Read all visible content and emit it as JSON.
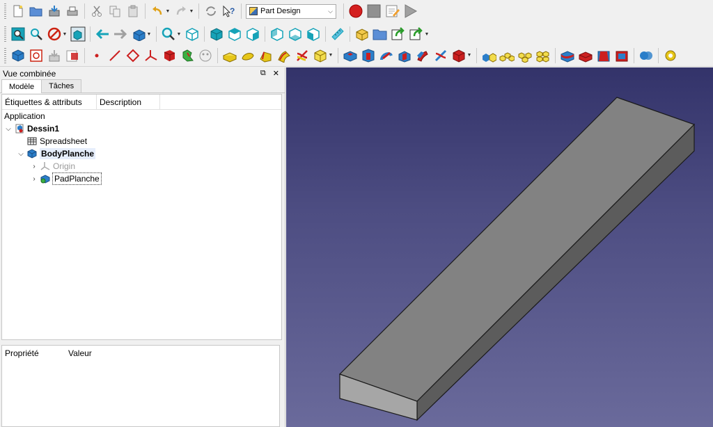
{
  "toolbar": {
    "workbench": "Part Design",
    "colors": {
      "record": "#d42020",
      "stop": "#909090",
      "play": "#a0a0a0",
      "nav_arrow": "#16a3b8",
      "cube_blue": "#2b7ec9",
      "pd_red": "#cc2020",
      "pd_yellow": "#e6c619"
    }
  },
  "combo": {
    "title": "Vue combinée",
    "tabs": [
      "Modèle",
      "Tâches"
    ],
    "columns": [
      "Étiquettes & attributs",
      "Description"
    ],
    "section": "Application",
    "tree": [
      {
        "label": "Dessin1",
        "level": 0,
        "bold": true,
        "expanded": true,
        "icon": "document-icon"
      },
      {
        "label": "Spreadsheet",
        "level": 1,
        "bold": false,
        "icon": "spreadsheet-icon"
      },
      {
        "label": "BodyPlanche",
        "level": 1,
        "bold": true,
        "expanded": true,
        "icon": "body-icon"
      },
      {
        "label": "Origin",
        "level": 2,
        "bold": false,
        "grey": true,
        "collapsed": true,
        "icon": "origin-icon"
      },
      {
        "label": "PadPlanche",
        "level": 2,
        "bold": false,
        "collapsed": true,
        "icon": "pad-icon"
      }
    ]
  },
  "properties": {
    "columns": [
      "Propriété",
      "Valeur"
    ]
  },
  "viewport": {
    "background_top": "#33336a",
    "background_bottom": "#6a6a9b",
    "shape_color": "#7f7f7f"
  }
}
